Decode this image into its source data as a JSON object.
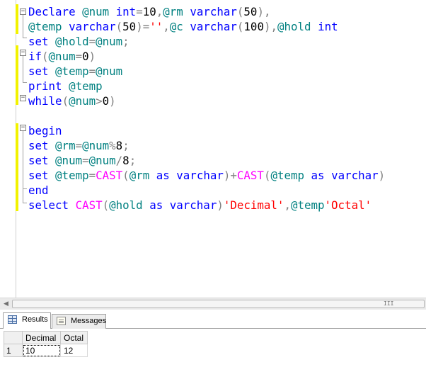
{
  "editor": {
    "lines": [
      [
        {
          "t": "Declare ",
          "c": "kw"
        },
        {
          "t": "@num",
          "c": "var"
        },
        {
          "t": " ",
          "c": "num"
        },
        {
          "t": "int",
          "c": "kw"
        },
        {
          "t": "=",
          "c": "op"
        },
        {
          "t": "10",
          "c": "num"
        },
        {
          "t": ",",
          "c": "op"
        },
        {
          "t": "@rm",
          "c": "var"
        },
        {
          "t": " ",
          "c": "num"
        },
        {
          "t": "varchar",
          "c": "kw"
        },
        {
          "t": "(",
          "c": "op"
        },
        {
          "t": "50",
          "c": "num"
        },
        {
          "t": "),",
          "c": "op"
        }
      ],
      [
        {
          "t": "@temp",
          "c": "var"
        },
        {
          "t": " ",
          "c": "num"
        },
        {
          "t": "varchar",
          "c": "kw"
        },
        {
          "t": "(",
          "c": "op"
        },
        {
          "t": "50",
          "c": "num"
        },
        {
          "t": ")=",
          "c": "op"
        },
        {
          "t": "''",
          "c": "str"
        },
        {
          "t": ",",
          "c": "op"
        },
        {
          "t": "@c",
          "c": "var"
        },
        {
          "t": " ",
          "c": "num"
        },
        {
          "t": "varchar",
          "c": "kw"
        },
        {
          "t": "(",
          "c": "op"
        },
        {
          "t": "100",
          "c": "num"
        },
        {
          "t": "),",
          "c": "op"
        },
        {
          "t": "@hold",
          "c": "var"
        },
        {
          "t": " ",
          "c": "num"
        },
        {
          "t": "int",
          "c": "kw"
        }
      ],
      [
        {
          "t": "set ",
          "c": "kw"
        },
        {
          "t": "@hold",
          "c": "var"
        },
        {
          "t": "=",
          "c": "op"
        },
        {
          "t": "@num",
          "c": "var"
        },
        {
          "t": ";",
          "c": "op"
        }
      ],
      [
        {
          "t": "if",
          "c": "kw"
        },
        {
          "t": "(",
          "c": "op"
        },
        {
          "t": "@num",
          "c": "var"
        },
        {
          "t": "=",
          "c": "op"
        },
        {
          "t": "0",
          "c": "num"
        },
        {
          "t": ")",
          "c": "op"
        }
      ],
      [
        {
          "t": "set ",
          "c": "kw"
        },
        {
          "t": "@temp",
          "c": "var"
        },
        {
          "t": "=",
          "c": "op"
        },
        {
          "t": "@num",
          "c": "var"
        }
      ],
      [
        {
          "t": "print ",
          "c": "kw"
        },
        {
          "t": "@temp",
          "c": "var"
        }
      ],
      [
        {
          "t": "while",
          "c": "kw"
        },
        {
          "t": "(",
          "c": "op"
        },
        {
          "t": "@num",
          "c": "var"
        },
        {
          "t": ">",
          "c": "op"
        },
        {
          "t": "0",
          "c": "num"
        },
        {
          "t": ")",
          "c": "op"
        }
      ],
      [],
      [
        {
          "t": "begin",
          "c": "kw"
        }
      ],
      [
        {
          "t": "set ",
          "c": "kw"
        },
        {
          "t": "@rm",
          "c": "var"
        },
        {
          "t": "=",
          "c": "op"
        },
        {
          "t": "@num",
          "c": "var"
        },
        {
          "t": "%",
          "c": "op"
        },
        {
          "t": "8",
          "c": "num"
        },
        {
          "t": ";",
          "c": "op"
        }
      ],
      [
        {
          "t": "set ",
          "c": "kw"
        },
        {
          "t": "@num",
          "c": "var"
        },
        {
          "t": "=",
          "c": "op"
        },
        {
          "t": "@num",
          "c": "var"
        },
        {
          "t": "/",
          "c": "op"
        },
        {
          "t": "8",
          "c": "num"
        },
        {
          "t": ";",
          "c": "op"
        }
      ],
      [
        {
          "t": "set ",
          "c": "kw"
        },
        {
          "t": "@temp",
          "c": "var"
        },
        {
          "t": "=",
          "c": "op"
        },
        {
          "t": "CAST",
          "c": "fn"
        },
        {
          "t": "(",
          "c": "op"
        },
        {
          "t": "@rm",
          "c": "var"
        },
        {
          "t": " as ",
          "c": "kw"
        },
        {
          "t": "varchar",
          "c": "kw"
        },
        {
          "t": ")+",
          "c": "op"
        },
        {
          "t": "CAST",
          "c": "fn"
        },
        {
          "t": "(",
          "c": "op"
        },
        {
          "t": "@temp",
          "c": "var"
        },
        {
          "t": " as ",
          "c": "kw"
        },
        {
          "t": "varchar",
          "c": "kw"
        },
        {
          "t": ")",
          "c": "op"
        }
      ],
      [
        {
          "t": "end",
          "c": "kw"
        }
      ],
      [
        {
          "t": "select ",
          "c": "kw"
        },
        {
          "t": "CAST",
          "c": "fn"
        },
        {
          "t": "(",
          "c": "op"
        },
        {
          "t": "@hold",
          "c": "var"
        },
        {
          "t": " as ",
          "c": "kw"
        },
        {
          "t": "varchar",
          "c": "kw"
        },
        {
          "t": ")",
          "c": "op"
        },
        {
          "t": "'Decimal'",
          "c": "str"
        },
        {
          "t": ",",
          "c": "op"
        },
        {
          "t": "@temp",
          "c": "var"
        },
        {
          "t": "'Octal'",
          "c": "str"
        }
      ]
    ],
    "fold_toggle_symbol": "−",
    "colors": {
      "keyword": "#0000ff",
      "variable": "#008080",
      "string": "#ff0000",
      "function": "#ff00ff",
      "operator": "#808080",
      "change_marker": "#f2f200"
    }
  },
  "scrollbar": {
    "left_arrow": "◀",
    "grip": "III"
  },
  "results_pane": {
    "tabs": {
      "results": "Results",
      "messages": "Messages"
    },
    "grid": {
      "columns": [
        "Decimal",
        "Octal"
      ],
      "rows": [
        {
          "row_number": "1",
          "cells": [
            "10",
            "12"
          ]
        }
      ]
    }
  }
}
